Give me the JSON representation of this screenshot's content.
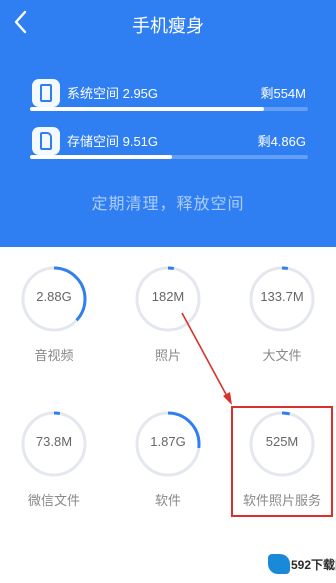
{
  "header": {
    "title": "手机瘦身",
    "back_icon": "chevron-left-icon",
    "background_color": "#2f7ff3"
  },
  "storage": {
    "system": {
      "label": "系统空间 2.95G",
      "remaining": "剩554M",
      "icon": "phone-icon",
      "used_fraction": 0.84
    },
    "storage": {
      "label": "存储空间 9.51G",
      "remaining": "剩4.86G",
      "icon": "sd-card-icon",
      "used_fraction": 0.51
    }
  },
  "tagline": "定期清理，释放空间",
  "categories": [
    {
      "value": "2.88G",
      "label": "音视频",
      "progress": 0.37
    },
    {
      "value": "182M",
      "label": "照片",
      "progress": 0.03
    },
    {
      "value": "133.7M",
      "label": "大文件",
      "progress": 0.03
    },
    {
      "value": "73.8M",
      "label": "微信文件",
      "progress": 0.03
    },
    {
      "value": "1.87G",
      "label": "软件",
      "progress": 0.27
    },
    {
      "value": "525M",
      "label": "软件照片服务",
      "progress": 0.04
    }
  ],
  "colors": {
    "ring_track": "#e4e8ee",
    "ring_progress": "#2f7ff3",
    "highlight": "#d9302a"
  },
  "watermark": {
    "text": "592下载网"
  }
}
